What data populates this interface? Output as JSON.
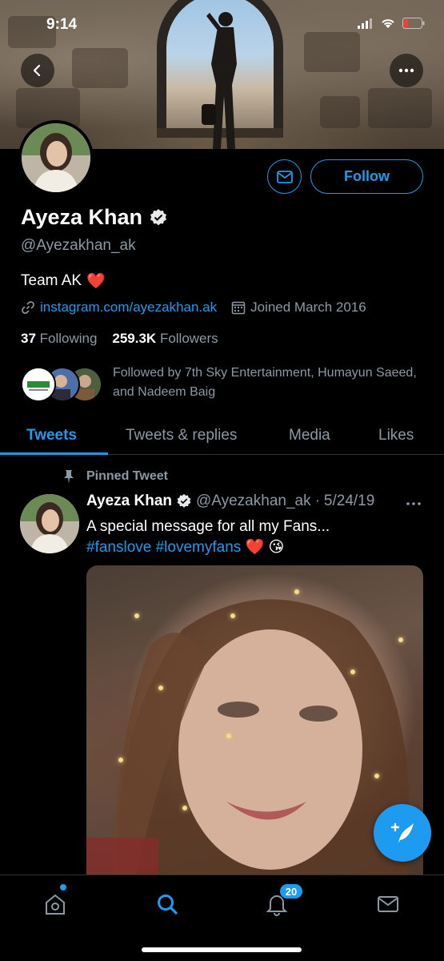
{
  "status": {
    "time": "9:14"
  },
  "profile": {
    "name": "Ayeza Khan",
    "handle": "@Ayezakhan_ak",
    "bio_text": "Team AK",
    "bio_emoji": "❤️",
    "link": "instagram.com/ayezakhan.ak",
    "joined": "Joined March 2016",
    "following_count": "37",
    "following_label": "Following",
    "followers_count": "259.3K",
    "followers_label": "Followers",
    "followed_by": "Followed by 7th Sky Entertainment, Humayun Saeed, and Nadeem Baig",
    "follow_label": "Follow"
  },
  "tabs": [
    {
      "label": "Tweets",
      "active": true
    },
    {
      "label": "Tweets & replies",
      "active": false
    },
    {
      "label": "Media",
      "active": false
    },
    {
      "label": "Likes",
      "active": false
    }
  ],
  "tweet": {
    "pinned_label": "Pinned Tweet",
    "author": "Ayeza Khan",
    "handle": "@Ayezakhan_ak",
    "dot": "·",
    "date": "5/24/19",
    "text": "A special message for all my Fans...",
    "tags": "#fanslove #lovemyfans",
    "emojis": "❤️ 😘"
  },
  "nav": {
    "notifications_badge": "20"
  },
  "colors": {
    "accent": "#1d9bf0",
    "background": "#000000",
    "muted": "#8b98a5"
  },
  "icons": [
    "back-icon",
    "more-icon",
    "mail-icon",
    "verified-icon",
    "link-icon",
    "calendar-icon",
    "pin-icon",
    "compose-icon",
    "home-icon",
    "search-icon",
    "bell-icon",
    "inbox-icon"
  ]
}
